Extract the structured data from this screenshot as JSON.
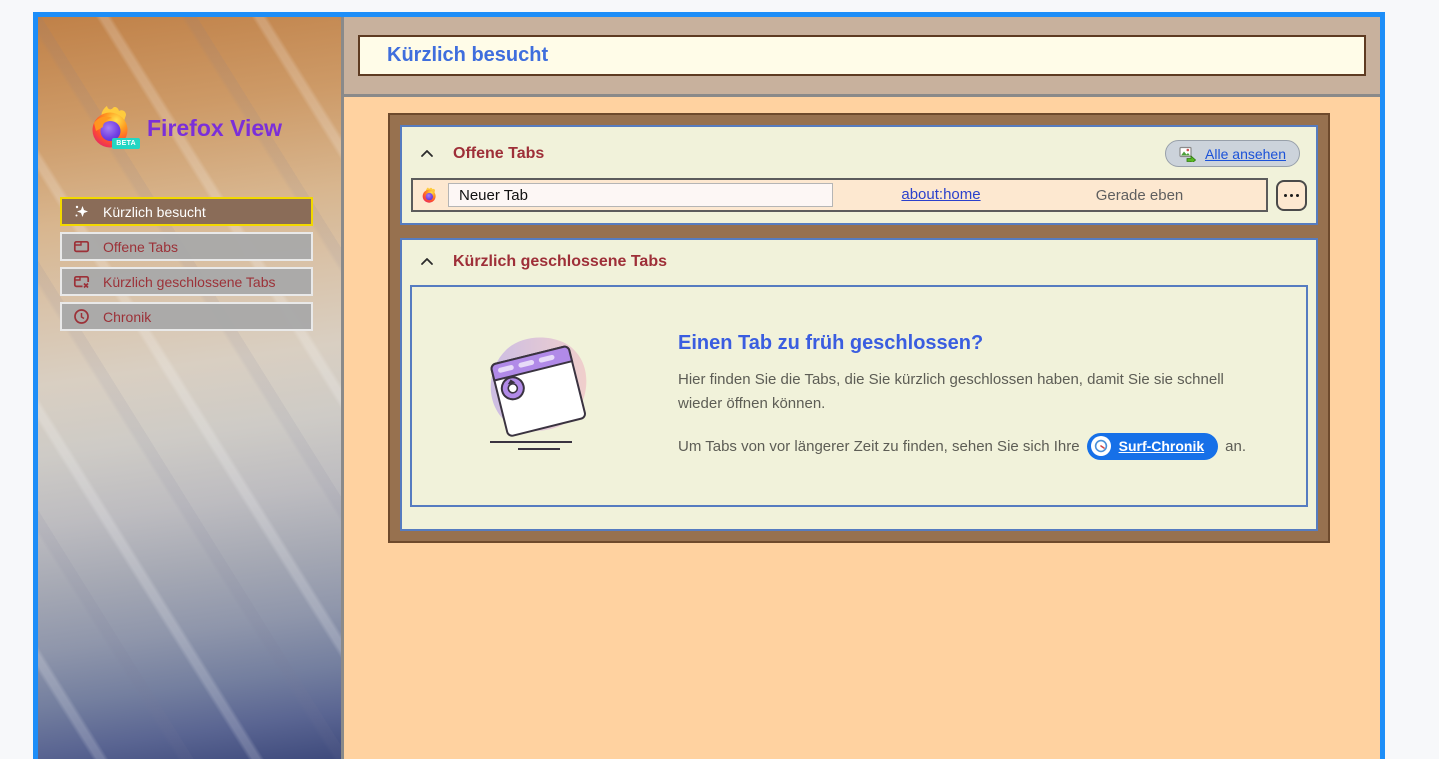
{
  "colors": {
    "frame_blue": "#1d8ef8",
    "page_bg": "#f7f8fa",
    "header_tan": "#c8b19d",
    "title_box_bg": "#fffce8",
    "title_blue": "#3f6edd",
    "content_orange": "#ffd2a0",
    "card_brown": "#97714f",
    "section_bg": "#f1f2da",
    "section_border_blue": "#567cc0",
    "section_heading_red": "#9e2f38",
    "row_peach": "#fde8d0",
    "link_blue": "#2b41cc",
    "brand_purple": "#7b2fd9",
    "selected_item_yellow": "#f2d800",
    "selected_item_brown": "#8a6c58",
    "history_pill_blue": "#1670e8",
    "empty_heading_blue": "#3a5de0"
  },
  "sidebar": {
    "brand": {
      "title": "Firefox View",
      "beta": "BETA"
    },
    "items": [
      {
        "label": "Kürzlich besucht"
      },
      {
        "label": "Offene Tabs"
      },
      {
        "label": "Kürzlich geschlossene Tabs"
      },
      {
        "label": "Chronik"
      }
    ]
  },
  "header": {
    "title": "Kürzlich besucht"
  },
  "open_tabs": {
    "heading": "Offene Tabs",
    "view_all_label": "Alle ansehen",
    "row": {
      "title": "Neuer Tab",
      "url": "about:home",
      "time": "Gerade eben"
    }
  },
  "closed_tabs": {
    "heading": "Kürzlich geschlossene Tabs",
    "empty_state": {
      "title": "Einen Tab zu früh geschlossen?",
      "body1": "Hier finden Sie die Tabs, die Sie kürzlich geschlossen haben, damit Sie sie schnell wieder öffnen können.",
      "body2_prefix": "Um Tabs von vor längerer Zeit zu finden, sehen Sie sich Ihre",
      "history_link": "Surf-Chronik",
      "body2_suffix": "an."
    }
  }
}
